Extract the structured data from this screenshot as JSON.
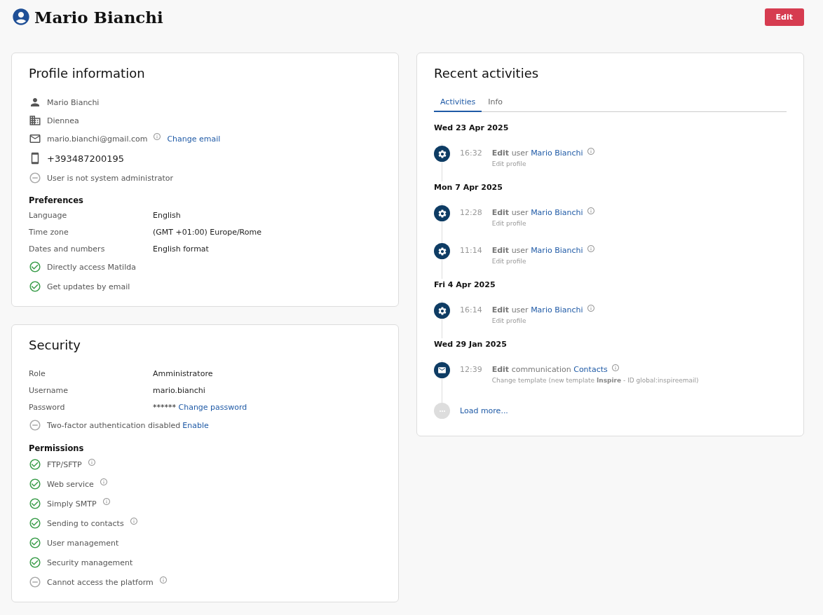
{
  "header": {
    "title": "Mario Bianchi",
    "edit_button": "Edit"
  },
  "profile": {
    "title": "Profile information",
    "items": [
      {
        "kind": "person",
        "text": "Mario Bianchi"
      },
      {
        "kind": "building",
        "text": "Diennea"
      },
      {
        "kind": "mail",
        "text": "mario.bianchi@gmail.com",
        "info": true,
        "link": "Change email"
      },
      {
        "kind": "phone",
        "text": "+393487200195",
        "large": true
      },
      {
        "kind": "minus",
        "text": "User is not system administrator"
      }
    ],
    "preferences": {
      "title": "Preferences",
      "fields": [
        {
          "label": "Language",
          "value": "English"
        },
        {
          "label": "Time zone",
          "value": "(GMT +01:00) Europe/Rome"
        },
        {
          "label": "Dates and numbers",
          "value": "English format"
        }
      ],
      "options": [
        {
          "label": "Directly access Matilda",
          "checked": true
        },
        {
          "label": "Get updates by email",
          "checked": true
        }
      ]
    }
  },
  "security": {
    "title": "Security",
    "fields": [
      {
        "label": "Role",
        "value": "Amministratore"
      },
      {
        "label": "Username",
        "value": "mario.bianchi"
      },
      {
        "label": "Password",
        "value": "******",
        "link": "Change password"
      }
    ],
    "two_factor": {
      "text": "Two-factor authentication disabled",
      "enabled": false,
      "link": "Enable"
    },
    "permissions": {
      "title": "Permissions",
      "items": [
        {
          "label": "FTP/SFTP",
          "granted": true,
          "info": true
        },
        {
          "label": "Web service",
          "granted": true,
          "info": true
        },
        {
          "label": "Simply SMTP",
          "granted": true,
          "info": true
        },
        {
          "label": "Sending to contacts",
          "granted": true,
          "info": true
        },
        {
          "label": "User management",
          "granted": true,
          "info": false
        },
        {
          "label": "Security management",
          "granted": true,
          "info": false
        },
        {
          "label": "Cannot access the platform",
          "granted": false,
          "info": true
        }
      ]
    }
  },
  "activities": {
    "title": "Recent activities",
    "tabs": [
      {
        "label": "Activities",
        "selected": true
      },
      {
        "label": "Info",
        "selected": false
      }
    ],
    "days": [
      {
        "date": "Wed 23 Apr 2025",
        "entries": [
          {
            "kind": "settings",
            "time": "16:32",
            "verb": "Edit",
            "object": "user",
            "link": "Mario Bianchi",
            "detail": "Edit profile"
          }
        ]
      },
      {
        "date": "Mon 7 Apr 2025",
        "entries": [
          {
            "kind": "settings",
            "time": "12:28",
            "verb": "Edit",
            "object": "user",
            "link": "Mario Bianchi",
            "detail": "Edit profile"
          },
          {
            "kind": "settings",
            "time": "11:14",
            "verb": "Edit",
            "object": "user",
            "link": "Mario Bianchi",
            "detail": "Edit profile"
          }
        ]
      },
      {
        "date": "Fri 4 Apr 2025",
        "entries": [
          {
            "kind": "settings",
            "time": "16:14",
            "verb": "Edit",
            "object": "user",
            "link": "Mario Bianchi",
            "detail": "Edit profile"
          }
        ]
      },
      {
        "date": "Wed 29 Jan 2025",
        "entries": [
          {
            "kind": "mail",
            "time": "12:39",
            "verb": "Edit",
            "object": "communication",
            "link": "Contacts",
            "detail": "Change template (new template **Inspire** - ID global:inspireemail)"
          }
        ]
      }
    ],
    "load_more": "Load more..."
  }
}
